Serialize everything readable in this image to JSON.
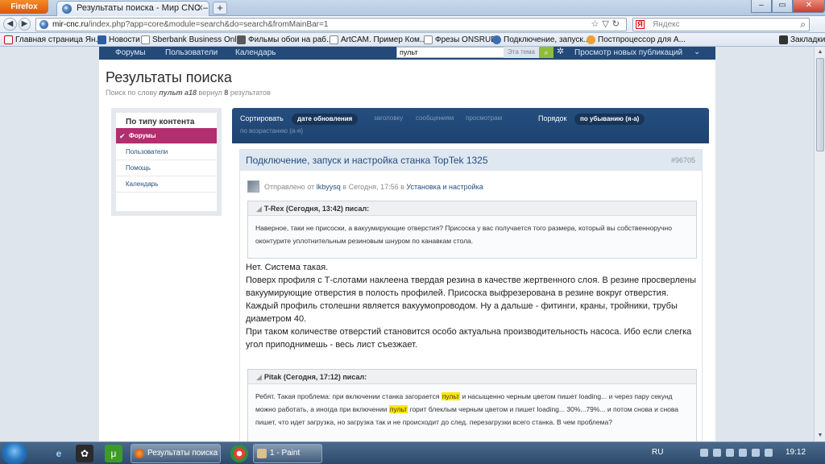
{
  "browser": {
    "app_button": "Firefox",
    "tab_title": "Результаты поиска - Мир CNC – фору...",
    "new_tab": "+",
    "url_host": "mir-cnc.ru",
    "url_path": "/index.php?app=core&module=search&do=search&fromMainBar=1",
    "search_placeholder": "Яндекс",
    "yandex_logo": "Я",
    "bookmarks_label": "Закладки",
    "bookmarks": [
      "Главная страница Ян...",
      "Новости",
      "Sberbank Business Onl...",
      "Фильмы обои на раб...",
      "ArtCAM. Пример Ком...",
      "Фрезы ONSRUD",
      "Подключение, запуск...",
      "Постпроцессор для А..."
    ]
  },
  "site_nav": {
    "items": [
      "Форумы",
      "Пользователи",
      "Календарь"
    ],
    "search_value": "пульт",
    "search_scope": "Эта тема",
    "new_posts": "Просмотр новых публикаций"
  },
  "page": {
    "title": "Результаты поиска",
    "subtitle_prefix": "Поиск по слову",
    "subtitle_query": "пульт а18",
    "subtitle_middle": "вернул",
    "subtitle_count": "8",
    "subtitle_suffix": "результатов"
  },
  "filter": {
    "heading": "По типу контента",
    "items": [
      "Форумы",
      "Пользователи",
      "Помощь",
      "Календарь"
    ]
  },
  "sort": {
    "label": "Сортировать",
    "active": "дате обновления",
    "options": [
      "заголовку",
      "сообщениям",
      "просмотрам"
    ],
    "order_label": "Порядок",
    "order_active": "по убыванию (я-а)",
    "order_alt": "по возрастанию (а-я)"
  },
  "result": {
    "title": "Подключение, запуск и настройка станка TopTek 1325",
    "id": "#96705",
    "meta_prefix": "Отправлено от",
    "author": "lkbyysq",
    "meta_time": "в Сегодня, 17:56 в",
    "forum": "Установка и настройка",
    "quote1": {
      "header": "T-Rex (Сегодня, 13:42) писал:",
      "text": "Наверное, таки не присоски, а вакуумирующие отверстия? Присоска у вас получается того размера, который вы собственноручно оконтурите уплотнительным резиновым шнуром по канавкам стола."
    },
    "body": [
      "Нет. Система такая.",
      "Поверх профиля с Т-слотами наклеена твердая резина в качестве жертвенного слоя. В резине просверлены вакуумирующие отверстия в полость профилей. Присоска выфрезерована в резине вокруг отверстия.",
      "Каждый профиль столешни является вакуумопроводом. Ну а дальше - фитинги, краны, тройники, трубы диаметром 40.",
      "При таком количестве отверстий становится особо актуальна производительность насоса. Ибо если слегка угол приподнимешь - весь лист съезжает."
    ],
    "quote2": {
      "header": "Pitak (Сегодня, 17:12) писал:",
      "part1": "Ребят. Такая проблема: при включении станка загорается",
      "hl1": "пульт",
      "part2": "и насыщенно черным цветом пишет loading... и через пару секунд можно работать, а иногда при включении",
      "hl2": "пульт",
      "part3": "горит блеклым черным цветом и пишет loading... 30%...79%... и потом снова и снова пишет, что идет загрузка, но загрузка так и не происходит до след. перезагрузки всего станка. В чем проблема?"
    }
  },
  "taskbar": {
    "task1": "Результаты поиска ...",
    "task2": "1 - Paint",
    "lang": "RU",
    "time": "19:12"
  },
  "colors": {
    "nav_bg": "#234a78",
    "accent_magenta": "#b12e6f",
    "highlight": "#ffe800",
    "link": "#234f80"
  }
}
